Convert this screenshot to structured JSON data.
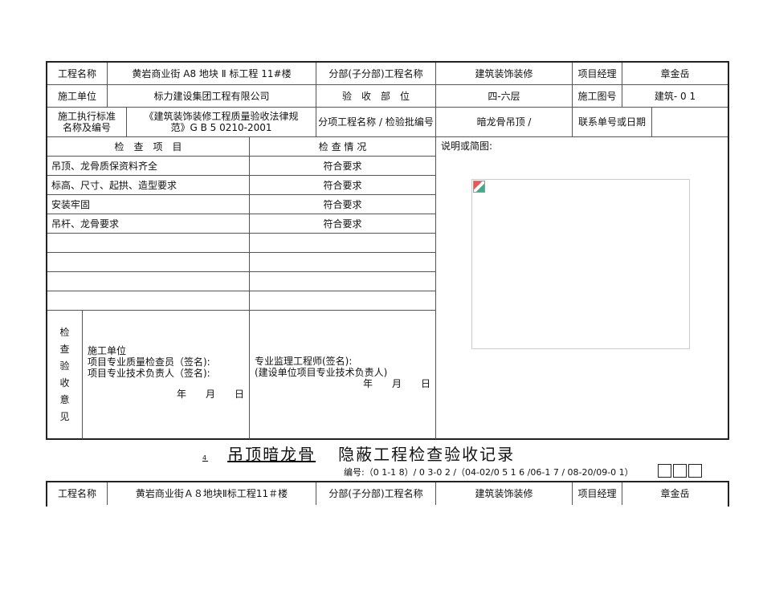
{
  "header": {
    "project_name_label": "工程名称",
    "project_name": "黄岩商业街 A8 地块 Ⅱ 标工程 11#楼",
    "division_label": "分部(子分部)工程名称",
    "division": "建筑装饰装修",
    "manager_label": "项目经理",
    "manager": "章金岳",
    "contractor_label": "施工单位",
    "contractor": "标力建设集团工程有限公司",
    "location_label": "验　收　部　位",
    "location": "四-六层",
    "drawing_label": "施工图号",
    "drawing": "建筑- 0 1",
    "standard_label": "施工执行标准名称及编号",
    "standard": "《建筑装饰装修工程质量验收法律规范》G B 5 0210-2001",
    "subitem_label": "分项工程名称 / 检验批编号",
    "subitem": "暗龙骨吊顶 /",
    "contact_label": "联系单号或日期",
    "contact": ""
  },
  "checks": {
    "item_header": "检　查　项　目",
    "status_header": "检 查 情 况",
    "rows": [
      {
        "item": "吊顶、龙骨质保资料齐全",
        "status": "符合要求"
      },
      {
        "item": "标高、尺寸、起拱、造型要求",
        "status": "符合要求"
      },
      {
        "item": "安装牢固",
        "status": "符合要求"
      },
      {
        "item": "吊杆、龙骨要求",
        "status": "符合要求"
      },
      {
        "item": "",
        "status": ""
      },
      {
        "item": "",
        "status": ""
      },
      {
        "item": "",
        "status": ""
      },
      {
        "item": "",
        "status": ""
      }
    ]
  },
  "notes_label": "说明或简图:",
  "opinion": {
    "label": "检查验收意见",
    "contractor_lines": [
      "施工单位",
      "项目专业质量检查员（签名):",
      "项目专业技术负责人（签名):"
    ],
    "supervisor_lines": [
      "专业监理工程师(签名):",
      "(建设单位项目专业技术负责人)"
    ],
    "date": "年　　月　　日"
  },
  "title": {
    "marker": "4",
    "subject": "吊顶暗龙骨",
    "rest": "隐蔽工程检查验收记录"
  },
  "code": "编号:（0 1-1 8）/ 0 3-0 2 /（04-02/0 5 1 6 /06-1 7 / 08-20/09-0 1）",
  "second": {
    "project_name_label": "工程名称",
    "project_name": "黄岩商业街Ａ８地块Ⅱ标工程11＃楼",
    "division_label": "分部(子分部)工程名称",
    "division": "建筑装饰装修",
    "manager_label": "项目经理",
    "manager": "章金岳"
  }
}
